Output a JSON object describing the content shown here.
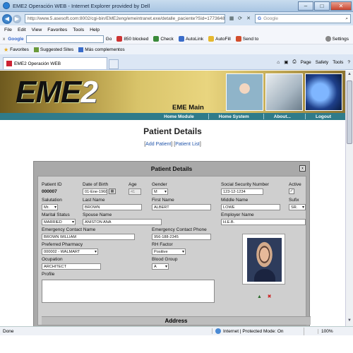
{
  "window": {
    "title": "EME2 Operación WEB - Internet Explorer provided by Dell",
    "minimize": "–",
    "maximize": "□",
    "close": "✕"
  },
  "address": {
    "url": "http://www.5.asesoft.com:8002/cgi-bin/EME2eng/emeintranet.exe/detalle_paciente?Sid=1773648",
    "search_engine": "Google",
    "search_placeholder": "Google"
  },
  "menu": [
    "File",
    "Edit",
    "View",
    "Favorites",
    "Tools",
    "Help"
  ],
  "google_toolbar": {
    "close": "x",
    "logo": "Google",
    "go": "Go",
    "blocked": "850 blocked",
    "check": "Check",
    "autolink": "AutoLink",
    "autofill": "AutoFill",
    "sendto": "Send to",
    "settings": "Settings"
  },
  "favorites_bar": {
    "favorites": "Favorites",
    "suggested": "Suggested Sites",
    "more": "Más complementos"
  },
  "tab": {
    "label": "EME2 Operación WEB"
  },
  "command_bar": [
    "Page",
    "Safety",
    "Tools"
  ],
  "site": {
    "logo_main": "EME",
    "logo_num": "2",
    "subtitle": "EME Main",
    "nav": [
      "Home Module",
      "Home System",
      "About...",
      "Logout"
    ]
  },
  "page": {
    "title": "Patient Details",
    "link_open": "[",
    "link_add": "Add Patient",
    "link_mid": "] [",
    "link_list": "Patient List",
    "link_close": "]"
  },
  "panel": {
    "title": "Patient Details",
    "close": "x",
    "labels": {
      "patient_id": "Patient ID",
      "dob": "Date of Birth",
      "age": "Age",
      "gender": "Gender",
      "ssn": "Social Security Number",
      "active": "Active",
      "salutation": "Salutation",
      "last_name": "Last Name",
      "first_name": "First Name",
      "middle_name": "Middle Name",
      "suffix": "Sufix",
      "marital": "Marital Status",
      "spouse": "Spouse Name",
      "employer": "Employer Name",
      "emergency_contact": "Emergency Contact Name",
      "emergency_phone": "Emergency Contact Phone",
      "pharmacy": "Preferred Pharmacy",
      "rh": "RH Factor",
      "occupation": "Ocupation",
      "blood": "Blood Group",
      "profile": "Profile"
    },
    "values": {
      "patient_id": "000007",
      "dob": "01-Ene-1968",
      "age": "41",
      "gender": "M",
      "ssn": "123-12-1234",
      "active": "✓",
      "salutation": "Mr.",
      "last_name": "BROWN",
      "first_name": "ALBERT",
      "middle_name": "LOWE",
      "suffix": "SR.",
      "marital": "MARRIED",
      "spouse": "ANISTON ANA",
      "employer": "H.E.B.",
      "emergency_contact": "BROWN WILLIAM",
      "emergency_phone": "956-188-2345",
      "pharmacy": "000002 - WALMART",
      "rh": "Positive",
      "occupation": "ARCHITECT",
      "blood": "A",
      "profile": ""
    },
    "address_header": "Address"
  },
  "status": {
    "text": "Done",
    "zone": "Internet | Protected Mode: On",
    "zoom": "100%"
  }
}
